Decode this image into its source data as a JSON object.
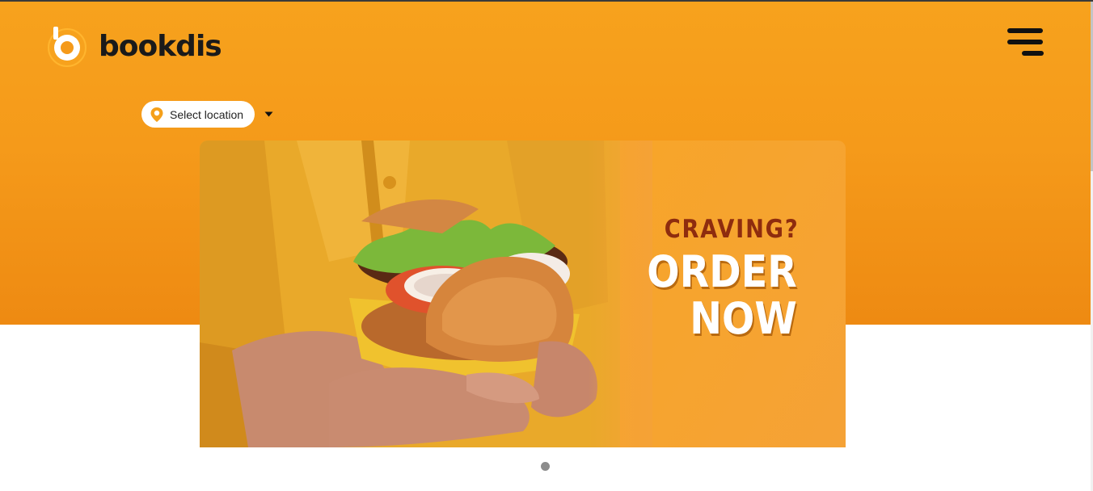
{
  "brand": {
    "name": "bookdis",
    "accent": "#f7a21d",
    "dark": "#1a1a1a"
  },
  "header": {
    "menu_icon": "hamburger-menu-icon"
  },
  "location": {
    "label": "Select location",
    "pin_icon": "map-pin-icon",
    "dropdown_icon": "caret-down-icon"
  },
  "banner": {
    "headline_small": "CRAVING?",
    "headline_line1": "ORDER",
    "headline_line2": "NOW",
    "image": "burger-in-hands-photo",
    "headline_small_color": "#8e2c0e",
    "headline_color": "#ffffff"
  },
  "carousel": {
    "active_slide": 1,
    "slide_count": 1
  }
}
